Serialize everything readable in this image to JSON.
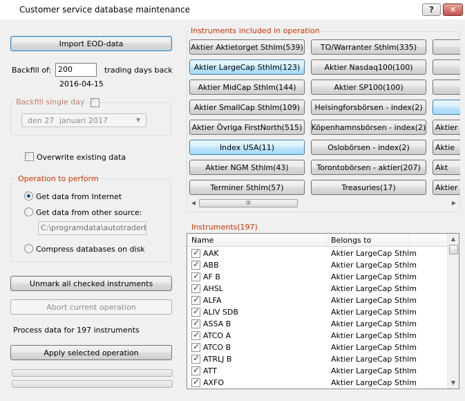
{
  "window": {
    "title": "Customer service database maintenance",
    "help_label": "?",
    "close_label": "✕"
  },
  "left": {
    "import_label": "Import EOD-data",
    "backfill_label": "Backfill of:",
    "backfill_value": "200",
    "backfill_suffix": "trading days back",
    "backfill_date": "2016-04-15",
    "single_day_title": "Backfill single day",
    "single_day_date": {
      "day": "den 27",
      "month": "januari",
      "year": "2017"
    },
    "overwrite_label": "Overwrite existing data",
    "operation_title": "Operation to perform",
    "op_internet": "Get data from Internet",
    "op_other": "Get data from other source:",
    "op_path": "C:\\programdata\\autotraderbas\\",
    "op_compress": "Compress databases on disk",
    "unmark_label": "Unmark all checked instruments",
    "abort_label": "Abort current operation",
    "process_text": "Process data for 197 instruments",
    "apply_label": "Apply selected operation"
  },
  "instruments_group": {
    "title": "Instruments included in operation",
    "col1": [
      "Aktier Aktietorget Sthlm(539)",
      "Aktier LargeCap Sthlm(123)",
      "Aktier MidCap Sthlm(144)",
      "Aktier SmallCap Sthlm(109)",
      "Aktier Övriga FirstNorth(515)",
      "Index USA(11)",
      "Aktier NGM Sthlm(43)",
      "Terminer Sthlm(57)"
    ],
    "col2": [
      "TO/Warranter Sthlm(335)",
      "Aktier Nasdaq100(100)",
      "Aktier SP100(100)",
      "Helsingforsbörsen - index(2)",
      "Köpenhamnsbörsen - index(2)",
      "Oslobörsen - index(2)",
      "Torontobörsen - aktier(207)",
      "Treasuries(17)"
    ],
    "col3": [
      "",
      "",
      "",
      "",
      "Aktier L",
      "Aktie",
      "Akt",
      "Aktier"
    ],
    "scroll_thumb": "III"
  },
  "instrument_list": {
    "title": "Instruments(197)",
    "headers": {
      "name": "Name",
      "belongs": "Belongs to"
    },
    "rows": [
      {
        "name": "AAK",
        "belongs": "Aktier LargeCap Sthlm"
      },
      {
        "name": "ABB",
        "belongs": "Aktier LargeCap Sthlm"
      },
      {
        "name": "AF B",
        "belongs": "Aktier LargeCap Sthlm"
      },
      {
        "name": "AHSL",
        "belongs": "Aktier LargeCap Sthlm"
      },
      {
        "name": "ALFA",
        "belongs": "Aktier LargeCap Sthlm"
      },
      {
        "name": "ALIV SDB",
        "belongs": "Aktier LargeCap Sthlm"
      },
      {
        "name": "ASSA B",
        "belongs": "Aktier LargeCap Sthlm"
      },
      {
        "name": "ATCO A",
        "belongs": "Aktier LargeCap Sthlm"
      },
      {
        "name": "ATCO B",
        "belongs": "Aktier LargeCap Sthlm"
      },
      {
        "name": "ATRLJ B",
        "belongs": "Aktier LargeCap Sthlm"
      },
      {
        "name": "ATT",
        "belongs": "Aktier LargeCap Sthlm"
      },
      {
        "name": "AXFO",
        "belongs": "Aktier LargeCap Sthlm"
      }
    ]
  }
}
